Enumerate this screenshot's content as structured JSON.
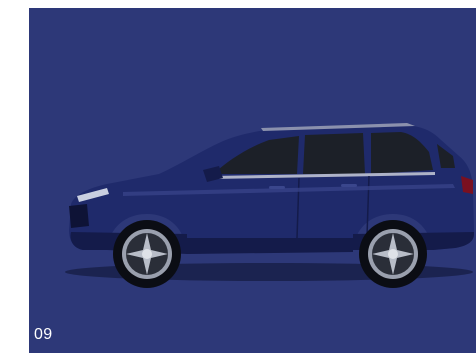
{
  "slide": {
    "number": "09",
    "background_color": "#2d3878",
    "text_color": "#ffffff",
    "image_subject": "suv-side-view-icon",
    "car_color": "#1f2a6b"
  }
}
